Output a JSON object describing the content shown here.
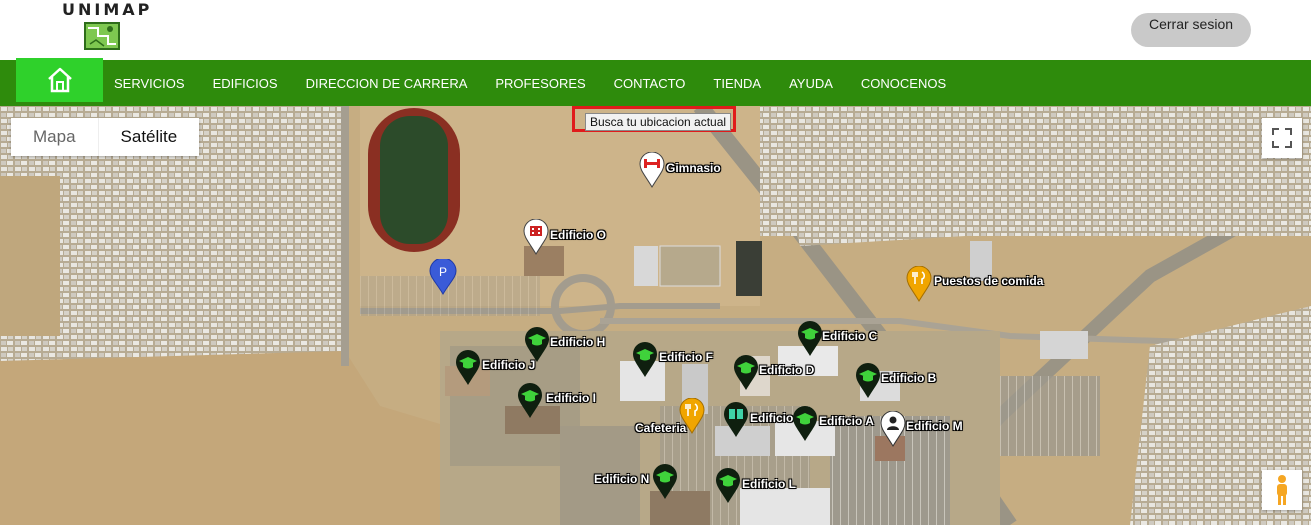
{
  "header": {
    "logo_text": "UNIMAP",
    "logout_label": "Cerrar sesion"
  },
  "nav": {
    "home_icon": "home-icon",
    "items": [
      "SERVICIOS",
      "EDIFICIOS",
      "DIRECCION DE CARRERA",
      "PROFESORES",
      "CONTACTO",
      "TIENDA",
      "AYUDA",
      "CONOCENOS"
    ]
  },
  "map": {
    "type_options": [
      "Mapa",
      "Satélite"
    ],
    "selected_type": "Satélite",
    "search_button": "Busca tu ubicacion actual",
    "markers": {
      "gimnasio": "Gimnasio",
      "edificio_o": "Edificio O",
      "puestos": "Puestos de comida",
      "edificio_h": "Edificio H",
      "edificio_c": "Edificio C",
      "edificio_j": "Edificio J",
      "edificio_f": "Edificio F",
      "edificio_d": "Edificio D",
      "edificio_b": "Edificio B",
      "edificio_i": "Edificio I",
      "cafeteria": "Cafeteria",
      "edificio_k": "Edificio",
      "edificio_a": "Edificio A",
      "edificio_m": "Edificio M",
      "edificio_n": "Edificio N",
      "edificio_l": "Edificio L"
    }
  },
  "colors": {
    "nav_bg": "#2e8b0c",
    "home_bg": "#2fd12b",
    "marker_green": "#0f1f0f",
    "marker_food": "#f0a500",
    "search_border": "#e01b1b"
  }
}
